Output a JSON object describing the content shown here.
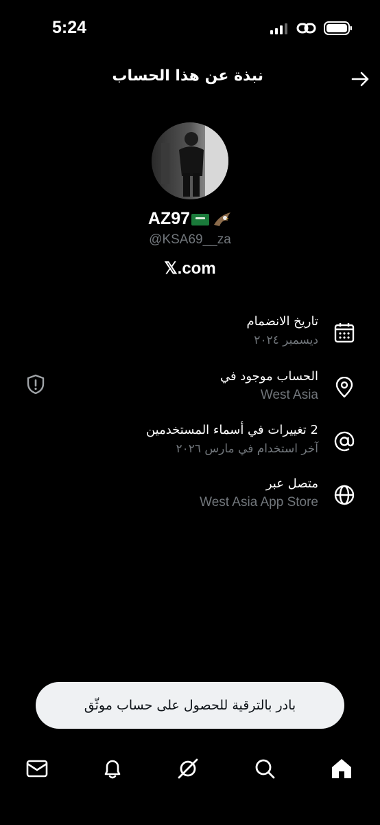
{
  "status_bar": {
    "time": "5:24"
  },
  "header": {
    "title": "نبذة عن هذا الحساب"
  },
  "profile": {
    "display_name": "AZ97",
    "handle": "@KSA69__za",
    "site": "𝕏.com"
  },
  "info_rows": [
    {
      "title": "تاريخ الانضمام",
      "subtitle": "ديسمبر ٢٠٢٤",
      "icon": "calendar-icon"
    },
    {
      "title": "الحساب موجود في",
      "subtitle": "West Asia",
      "icon": "location-pin-icon"
    },
    {
      "title": "2 تغييرات في أسماء المستخدمين",
      "subtitle": "آخر استخدام في مارس ٢٠٢٦",
      "icon": "at-sign-icon"
    },
    {
      "title": "متصل عبر",
      "subtitle": "West Asia App Store",
      "icon": "globe-icon"
    }
  ],
  "upgrade": {
    "label": "بادر بالترقية للحصول على حساب موثّق"
  },
  "bottom_nav": [
    "mail-icon",
    "bell-icon",
    "grok-icon",
    "search-icon",
    "home-icon"
  ],
  "colors": {
    "background": "#000000",
    "text": "#e7e9ea",
    "muted": "#71767b",
    "banner": "#eff1f3"
  }
}
